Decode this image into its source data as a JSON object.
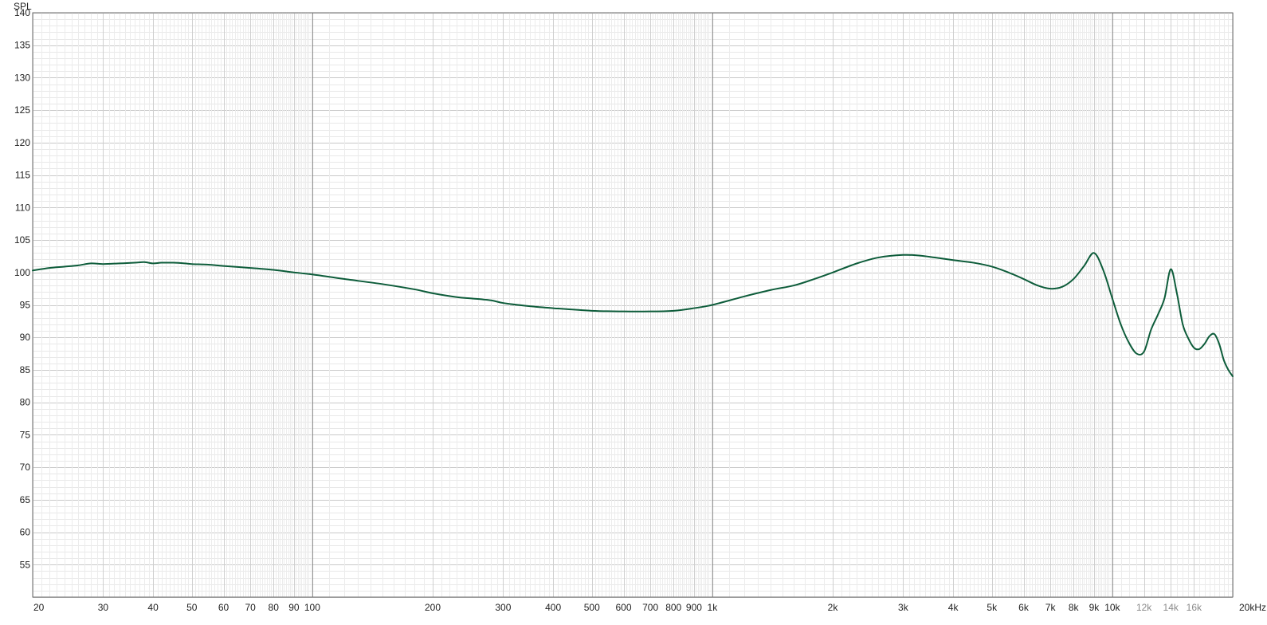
{
  "chart_data": {
    "type": "line",
    "title": "",
    "ylabel": "SPL",
    "xlabel": "",
    "x_scale": "log",
    "xlim": [
      20,
      20000
    ],
    "ylim": [
      50,
      140
    ],
    "grid": true,
    "y_ticks": [
      140,
      135,
      130,
      125,
      120,
      115,
      110,
      105,
      100,
      95,
      90,
      85,
      80,
      75,
      70,
      65,
      60,
      55
    ],
    "y_tick_labels": [
      "140",
      "135",
      "130",
      "125",
      "120",
      "115",
      "110",
      "105",
      "100",
      "95",
      "90",
      "85",
      "80",
      "75",
      "70",
      "65",
      "60",
      "55"
    ],
    "x_ticks": [
      20,
      30,
      40,
      50,
      60,
      70,
      80,
      90,
      100,
      200,
      300,
      400,
      500,
      600,
      700,
      800,
      900,
      1000,
      2000,
      3000,
      4000,
      5000,
      6000,
      7000,
      8000,
      9000,
      10000,
      12000,
      14000,
      16000,
      20000
    ],
    "x_tick_labels": [
      "20",
      "30",
      "40",
      "50",
      "60",
      "70",
      "80",
      "90",
      "100",
      "200",
      "300",
      "400",
      "500",
      "600",
      "700",
      "800",
      "900",
      "1k",
      "2k",
      "3k",
      "4k",
      "5k",
      "6k",
      "7k",
      "8k",
      "9k",
      "10k",
      "12k",
      "14k",
      "16k",
      "20kHz"
    ],
    "x_tick_minor": [
      false,
      false,
      false,
      false,
      false,
      false,
      false,
      false,
      false,
      false,
      false,
      false,
      false,
      false,
      false,
      false,
      false,
      false,
      false,
      false,
      false,
      false,
      false,
      false,
      false,
      false,
      false,
      true,
      true,
      true,
      false
    ],
    "series": [
      {
        "name": "",
        "color": "#0d5c3a",
        "x": [
          20,
          22,
          24,
          26,
          28,
          30,
          33,
          36,
          38,
          40,
          42,
          45,
          48,
          50,
          55,
          60,
          70,
          80,
          90,
          100,
          120,
          150,
          180,
          200,
          230,
          250,
          280,
          300,
          350,
          400,
          500,
          600,
          700,
          800,
          900,
          1000,
          1200,
          1400,
          1600,
          1800,
          2000,
          2300,
          2600,
          3000,
          3300,
          3600,
          4000,
          4500,
          5000,
          5500,
          6000,
          6500,
          7000,
          7500,
          8000,
          8500,
          9000,
          9500,
          10000,
          10500,
          11000,
          11500,
          12000,
          12500,
          13000,
          13500,
          14000,
          14500,
          15000,
          15500,
          16000,
          16500,
          17000,
          17500,
          18000,
          18500,
          19000,
          19500,
          20000
        ],
        "y": [
          100.3,
          100.7,
          100.9,
          101.1,
          101.4,
          101.3,
          101.4,
          101.5,
          101.6,
          101.4,
          101.5,
          101.5,
          101.4,
          101.3,
          101.2,
          101.0,
          100.7,
          100.4,
          100.0,
          99.7,
          99.0,
          98.2,
          97.4,
          96.8,
          96.2,
          96.0,
          95.7,
          95.3,
          94.8,
          94.5,
          94.1,
          94.0,
          94.0,
          94.1,
          94.5,
          95.0,
          96.3,
          97.3,
          98.0,
          99.0,
          100.0,
          101.4,
          102.3,
          102.7,
          102.6,
          102.3,
          101.9,
          101.5,
          100.9,
          100.0,
          99.0,
          98.0,
          97.5,
          97.8,
          99.0,
          101.0,
          103.0,
          100.3,
          96.0,
          92.0,
          89.2,
          87.5,
          87.8,
          91.2,
          93.5,
          96.0,
          100.5,
          96.8,
          92.0,
          89.8,
          88.4,
          88.2,
          89.0,
          90.2,
          90.5,
          89.0,
          86.5,
          85.0,
          84.0
        ]
      }
    ]
  }
}
